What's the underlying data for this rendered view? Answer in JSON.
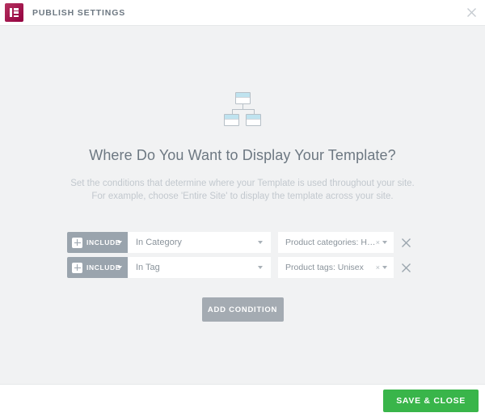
{
  "header": {
    "logo_icon": "elementor-logo-icon",
    "title": "PUBLISH SETTINGS",
    "close_icon": "close-icon",
    "brand_color": "#93003f"
  },
  "main": {
    "hero_icon": "sitemap-icon",
    "title": "Where Do You Want to Display Your Template?",
    "subtitle_line1": "Set the conditions that determine where your Template is used throughout your site.",
    "subtitle_line2": "For example, choose 'Entire Site' to display the template across your site."
  },
  "conditions": {
    "rows": [
      {
        "type_label": "INCLUDE",
        "type_icon": "plus-icon",
        "name_value": "In Category",
        "value_value": "Product categories: Hoodie",
        "value_clear_icon": "clear-icon",
        "remove_icon": "remove-condition-icon"
      },
      {
        "type_label": "INCLUDE",
        "type_icon": "plus-icon",
        "name_value": "In Tag",
        "value_value": "Product tags: Unisex",
        "value_clear_icon": "clear-icon",
        "remove_icon": "remove-condition-icon"
      }
    ],
    "add_label": "ADD CONDITION"
  },
  "footer": {
    "save_label": "SAVE & CLOSE",
    "save_color": "#39b54a"
  }
}
